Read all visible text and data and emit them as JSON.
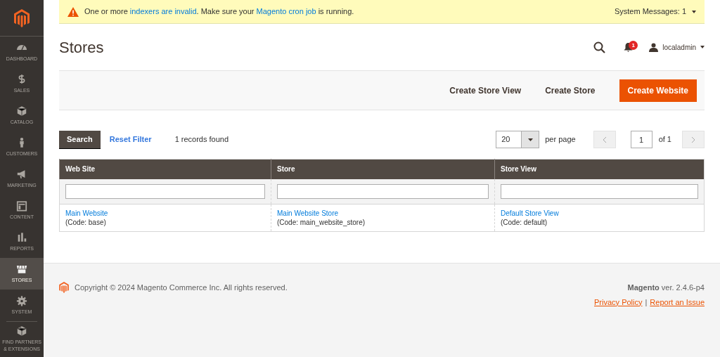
{
  "sidebar": {
    "items": [
      {
        "label": "DASHBOARD",
        "selected": false
      },
      {
        "label": "SALES",
        "selected": false
      },
      {
        "label": "CATALOG",
        "selected": false
      },
      {
        "label": "CUSTOMERS",
        "selected": false
      },
      {
        "label": "MARKETING",
        "selected": false
      },
      {
        "label": "CONTENT",
        "selected": false
      },
      {
        "label": "REPORTS",
        "selected": false
      },
      {
        "label": "STORES",
        "selected": true
      },
      {
        "label": "SYSTEM",
        "selected": false
      },
      {
        "label": "FIND PARTNERS & EXTENSIONS",
        "selected": false
      }
    ]
  },
  "system_message": {
    "segments": [
      {
        "kind": "text",
        "text": "One or more "
      },
      {
        "kind": "link",
        "text": "indexers are invalid"
      },
      {
        "kind": "text",
        "text": ". Make sure your "
      },
      {
        "kind": "link",
        "text": "Magento cron job"
      },
      {
        "kind": "text",
        "text": " is running."
      }
    ],
    "counter": "System Messages: 1"
  },
  "header": {
    "title": "Stores",
    "notification_count": "1",
    "user": "localadmin"
  },
  "actions": [
    {
      "label": "Create Store View",
      "kind": "secondary"
    },
    {
      "label": "Create Store",
      "kind": "secondary"
    },
    {
      "label": "Create Website",
      "kind": "primary"
    }
  ],
  "grid": {
    "search_button": "Search",
    "reset_link": "Reset Filter",
    "records": "1 records found",
    "per_page_value": "20",
    "per_page_label": "per page",
    "page": "1",
    "page_total": "of 1",
    "columns": [
      "Web Site",
      "Store",
      "Store View"
    ],
    "rows": [
      {
        "cells": [
          {
            "link": "Main Website",
            "code": "(Code: base)"
          },
          {
            "link": "Main Website Store",
            "code": "(Code: main_website_store)"
          },
          {
            "link": "Default Store View",
            "code": "(Code: default)"
          }
        ]
      }
    ]
  },
  "footer": {
    "copyright": "Copyright © 2024 Magento Commerce Inc. All rights reserved.",
    "version": "**Magento** ver. 2.4.6-p4",
    "links": [
      "Privacy Policy",
      "Report an Issue"
    ],
    "separator": "|"
  }
}
